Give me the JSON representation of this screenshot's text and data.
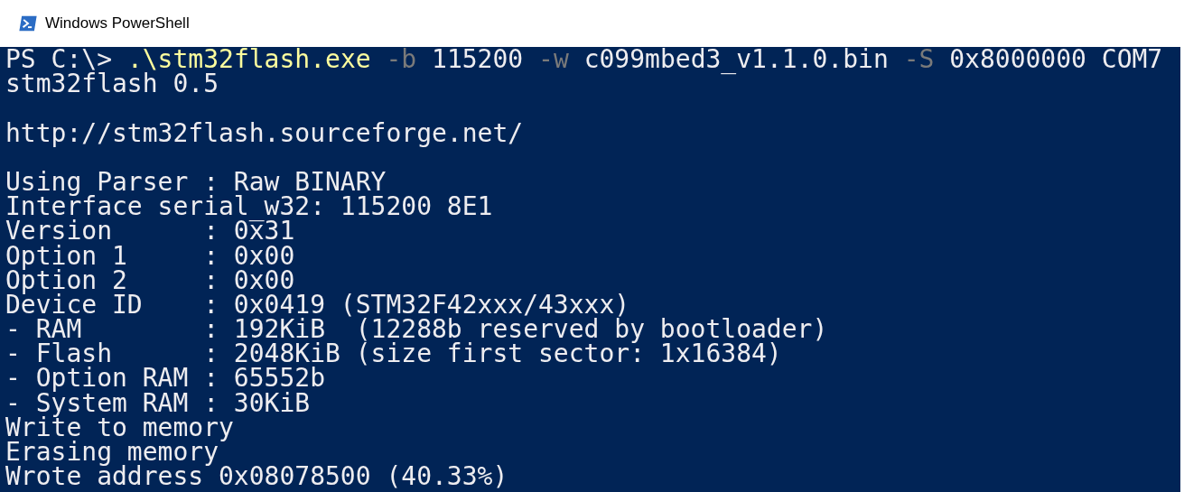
{
  "window": {
    "title": "Windows PowerShell"
  },
  "command": [
    {
      "kind": "prompt",
      "text": "PS C:\\>"
    },
    {
      "kind": "command",
      "text": ".\\stm32flash.exe"
    },
    {
      "kind": "parameter",
      "text": "-b"
    },
    {
      "kind": "argument",
      "text": "115200"
    },
    {
      "kind": "parameter",
      "text": "-w"
    },
    {
      "kind": "argument",
      "text": "c099mbed3_v1.1.0.bin"
    },
    {
      "kind": "parameter",
      "text": "-S"
    },
    {
      "kind": "argument",
      "text": "0x8000000"
    },
    {
      "kind": "argument",
      "text": "COM7"
    }
  ],
  "output_blocks": [
    [
      "stm32flash 0.5"
    ],
    [
      "http://stm32flash.sourceforge.net/"
    ],
    [
      "Using Parser : Raw BINARY",
      "Interface serial_w32: 115200 8E1",
      "Version      : 0x31",
      "Option 1     : 0x00",
      "Option 2     : 0x00",
      "Device ID    : 0x0419 (STM32F42xxx/43xxx)",
      "- RAM        : 192KiB  (12288b reserved by bootloader)",
      "- Flash      : 2048KiB (size first sector: 1x16384)",
      "- Option RAM : 65552b",
      "- System RAM : 30KiB",
      "Write to memory",
      "Erasing memory",
      "Wrote address 0x08078500 (40.33%)"
    ]
  ]
}
